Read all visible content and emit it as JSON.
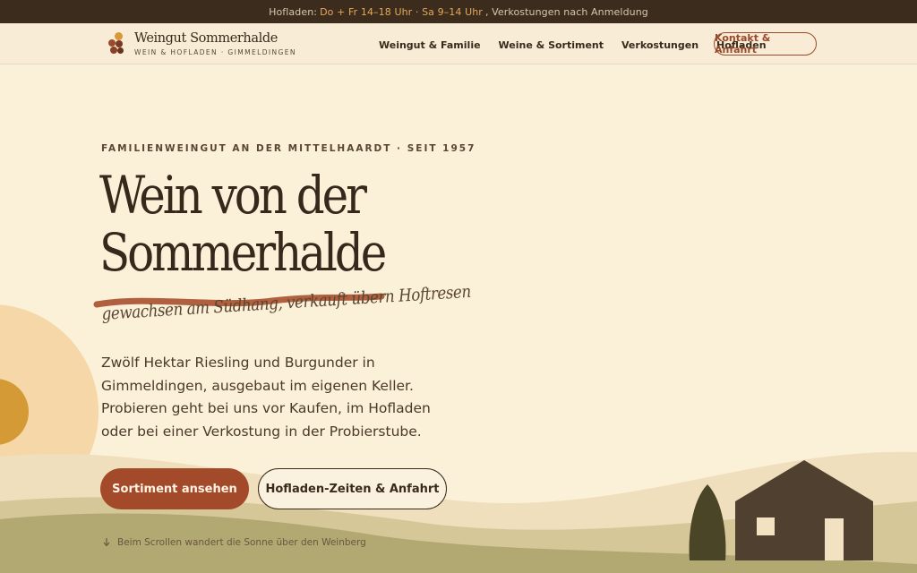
{
  "topbar": {
    "prefix": "Hofladen:",
    "hours": "Do + Fr 14–18 Uhr · Sa 9–14 Uhr",
    "suffix": ", Verkostungen nach Anmeldung"
  },
  "brand": {
    "name": "Weingut Sommerhalde",
    "sub": "WEIN & HOFLADEN · GIMMELDINGEN",
    "logo_icon": "grapes-icon"
  },
  "nav": {
    "items": [
      "Weingut & Familie",
      "Weine & Sortiment",
      "Verkostungen",
      "Hofladen"
    ],
    "cta": "Kontakt & Anfahrt"
  },
  "hero": {
    "eyebrow": "FAMILIENWEINGUT AN DER MITTELHAARDT · SEIT 1957",
    "title_line1": "Wein von der",
    "title_line2": "Sommerhalde",
    "tagline": "gewachsen am Südhang, verkauft übern Hoftresen",
    "description": "Zwölf Hektar Riesling und Burgunder in Gimmeldingen, ausgebaut im eigenen Keller. Probieren geht bei uns vor Kaufen, im Hofladen oder bei einer Verkostung in der Probierstube.",
    "primary_button": "Sortiment ansehen",
    "secondary_button": "Hofladen-Zeiten & Anfahrt",
    "scroll_hint": "Beim Scrollen wandert die Sonne über den Weinberg",
    "scroll_icon": "arrow-down-icon"
  },
  "colors": {
    "background": "#fbf0d8",
    "topbar": "#3c2c1e",
    "accent": "#a34a2a",
    "highlight": "#e6a857",
    "sun": "#d49a35",
    "hill_green": "#b1a872",
    "house": "#4f4030"
  }
}
